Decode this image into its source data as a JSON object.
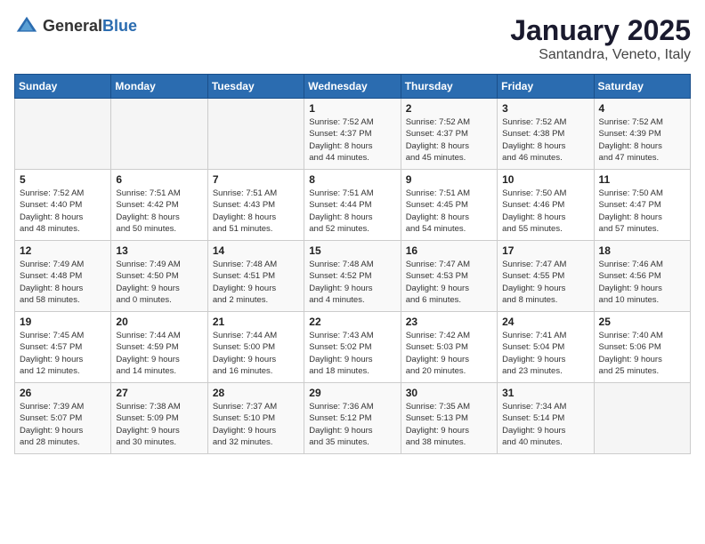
{
  "logo": {
    "text_general": "General",
    "text_blue": "Blue"
  },
  "title": {
    "month": "January 2025",
    "location": "Santandra, Veneto, Italy"
  },
  "headers": [
    "Sunday",
    "Monday",
    "Tuesday",
    "Wednesday",
    "Thursday",
    "Friday",
    "Saturday"
  ],
  "weeks": [
    [
      {
        "day": "",
        "info": ""
      },
      {
        "day": "",
        "info": ""
      },
      {
        "day": "",
        "info": ""
      },
      {
        "day": "1",
        "info": "Sunrise: 7:52 AM\nSunset: 4:37 PM\nDaylight: 8 hours\nand 44 minutes."
      },
      {
        "day": "2",
        "info": "Sunrise: 7:52 AM\nSunset: 4:37 PM\nDaylight: 8 hours\nand 45 minutes."
      },
      {
        "day": "3",
        "info": "Sunrise: 7:52 AM\nSunset: 4:38 PM\nDaylight: 8 hours\nand 46 minutes."
      },
      {
        "day": "4",
        "info": "Sunrise: 7:52 AM\nSunset: 4:39 PM\nDaylight: 8 hours\nand 47 minutes."
      }
    ],
    [
      {
        "day": "5",
        "info": "Sunrise: 7:52 AM\nSunset: 4:40 PM\nDaylight: 8 hours\nand 48 minutes."
      },
      {
        "day": "6",
        "info": "Sunrise: 7:51 AM\nSunset: 4:42 PM\nDaylight: 8 hours\nand 50 minutes."
      },
      {
        "day": "7",
        "info": "Sunrise: 7:51 AM\nSunset: 4:43 PM\nDaylight: 8 hours\nand 51 minutes."
      },
      {
        "day": "8",
        "info": "Sunrise: 7:51 AM\nSunset: 4:44 PM\nDaylight: 8 hours\nand 52 minutes."
      },
      {
        "day": "9",
        "info": "Sunrise: 7:51 AM\nSunset: 4:45 PM\nDaylight: 8 hours\nand 54 minutes."
      },
      {
        "day": "10",
        "info": "Sunrise: 7:50 AM\nSunset: 4:46 PM\nDaylight: 8 hours\nand 55 minutes."
      },
      {
        "day": "11",
        "info": "Sunrise: 7:50 AM\nSunset: 4:47 PM\nDaylight: 8 hours\nand 57 minutes."
      }
    ],
    [
      {
        "day": "12",
        "info": "Sunrise: 7:49 AM\nSunset: 4:48 PM\nDaylight: 8 hours\nand 58 minutes."
      },
      {
        "day": "13",
        "info": "Sunrise: 7:49 AM\nSunset: 4:50 PM\nDaylight: 9 hours\nand 0 minutes."
      },
      {
        "day": "14",
        "info": "Sunrise: 7:48 AM\nSunset: 4:51 PM\nDaylight: 9 hours\nand 2 minutes."
      },
      {
        "day": "15",
        "info": "Sunrise: 7:48 AM\nSunset: 4:52 PM\nDaylight: 9 hours\nand 4 minutes."
      },
      {
        "day": "16",
        "info": "Sunrise: 7:47 AM\nSunset: 4:53 PM\nDaylight: 9 hours\nand 6 minutes."
      },
      {
        "day": "17",
        "info": "Sunrise: 7:47 AM\nSunset: 4:55 PM\nDaylight: 9 hours\nand 8 minutes."
      },
      {
        "day": "18",
        "info": "Sunrise: 7:46 AM\nSunset: 4:56 PM\nDaylight: 9 hours\nand 10 minutes."
      }
    ],
    [
      {
        "day": "19",
        "info": "Sunrise: 7:45 AM\nSunset: 4:57 PM\nDaylight: 9 hours\nand 12 minutes."
      },
      {
        "day": "20",
        "info": "Sunrise: 7:44 AM\nSunset: 4:59 PM\nDaylight: 9 hours\nand 14 minutes."
      },
      {
        "day": "21",
        "info": "Sunrise: 7:44 AM\nSunset: 5:00 PM\nDaylight: 9 hours\nand 16 minutes."
      },
      {
        "day": "22",
        "info": "Sunrise: 7:43 AM\nSunset: 5:02 PM\nDaylight: 9 hours\nand 18 minutes."
      },
      {
        "day": "23",
        "info": "Sunrise: 7:42 AM\nSunset: 5:03 PM\nDaylight: 9 hours\nand 20 minutes."
      },
      {
        "day": "24",
        "info": "Sunrise: 7:41 AM\nSunset: 5:04 PM\nDaylight: 9 hours\nand 23 minutes."
      },
      {
        "day": "25",
        "info": "Sunrise: 7:40 AM\nSunset: 5:06 PM\nDaylight: 9 hours\nand 25 minutes."
      }
    ],
    [
      {
        "day": "26",
        "info": "Sunrise: 7:39 AM\nSunset: 5:07 PM\nDaylight: 9 hours\nand 28 minutes."
      },
      {
        "day": "27",
        "info": "Sunrise: 7:38 AM\nSunset: 5:09 PM\nDaylight: 9 hours\nand 30 minutes."
      },
      {
        "day": "28",
        "info": "Sunrise: 7:37 AM\nSunset: 5:10 PM\nDaylight: 9 hours\nand 32 minutes."
      },
      {
        "day": "29",
        "info": "Sunrise: 7:36 AM\nSunset: 5:12 PM\nDaylight: 9 hours\nand 35 minutes."
      },
      {
        "day": "30",
        "info": "Sunrise: 7:35 AM\nSunset: 5:13 PM\nDaylight: 9 hours\nand 38 minutes."
      },
      {
        "day": "31",
        "info": "Sunrise: 7:34 AM\nSunset: 5:14 PM\nDaylight: 9 hours\nand 40 minutes."
      },
      {
        "day": "",
        "info": ""
      }
    ]
  ]
}
